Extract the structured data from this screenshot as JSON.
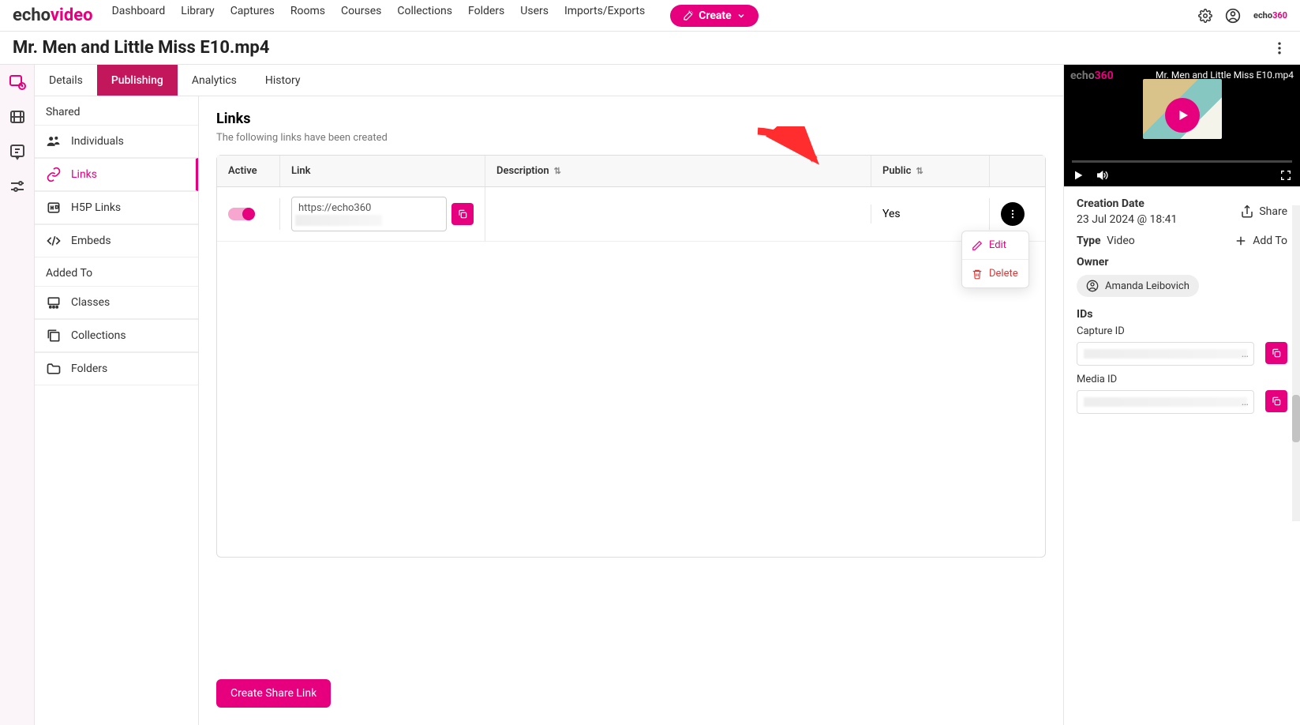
{
  "brand": {
    "part1": "echo",
    "part2": "video"
  },
  "nav": {
    "items": [
      "Dashboard",
      "Library",
      "Captures",
      "Rooms",
      "Courses",
      "Collections",
      "Folders",
      "Users",
      "Imports/Exports"
    ],
    "create": "Create"
  },
  "page": {
    "title": "Mr. Men and Little Miss E10.mp4"
  },
  "tabs": {
    "details": "Details",
    "publishing": "Publishing",
    "analytics": "Analytics",
    "history": "History"
  },
  "sidebar": {
    "group_shared": "Shared",
    "items_shared": {
      "individuals": "Individuals",
      "links": "Links",
      "h5p": "H5P Links",
      "embeds": "Embeds"
    },
    "group_added": "Added To",
    "items_added": {
      "classes": "Classes",
      "collections": "Collections",
      "folders": "Folders"
    }
  },
  "links_panel": {
    "heading": "Links",
    "subheading": "The following links have been created",
    "columns": {
      "active": "Active",
      "link": "Link",
      "description": "Description",
      "public": "Public"
    },
    "rows": [
      {
        "url_prefix": "https://echo360",
        "public": "Yes"
      }
    ],
    "menu": {
      "edit": "Edit",
      "delete": "Delete"
    },
    "create_button": "Create Share Link"
  },
  "info": {
    "filename": "Mr. Men and Little Miss E10.mp4",
    "creation_label": "Creation Date",
    "creation_value": "23 Jul 2024 @ 18:41",
    "share": "Share",
    "type_label": "Type",
    "type_value": "Video",
    "addto": "Add To",
    "owner_label": "Owner",
    "owner_value": "Amanda Leibovich",
    "ids_label": "IDs",
    "capture_id_label": "Capture ID",
    "media_id_label": "Media ID"
  }
}
